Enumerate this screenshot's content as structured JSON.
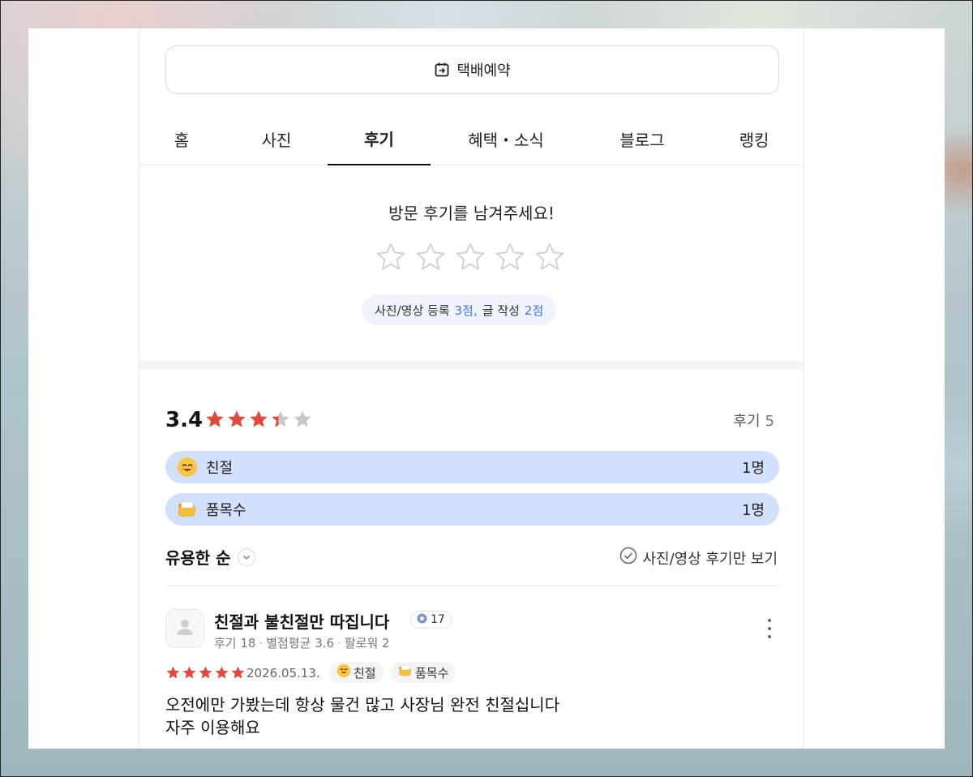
{
  "delivery_button": {
    "label": "택배예약",
    "icon": "calendar-arrow-icon"
  },
  "tabs": [
    {
      "label": "홈"
    },
    {
      "label": "사진"
    },
    {
      "label": "후기",
      "active": true
    },
    {
      "label": "혜택・소식"
    },
    {
      "label": "블로그"
    },
    {
      "label": "랭킹"
    }
  ],
  "write_review": {
    "prompt": "방문 후기를 남겨주세요!",
    "star_count": 5,
    "points": {
      "photo_label": "사진/영상 등록",
      "photo_points": "3점,",
      "text_label": "글 작성",
      "text_points": "2점"
    }
  },
  "summary": {
    "score": "3.4",
    "score_value": 3.4,
    "review_label": "후기",
    "review_count": "5",
    "keywords": [
      {
        "emoji": "smiling-face-icon",
        "label": "친절",
        "count": "1명"
      },
      {
        "emoji": "open-folder-icon",
        "label": "품목수",
        "count": "1명"
      }
    ]
  },
  "controls": {
    "sort_label": "유용한 순",
    "photo_filter_label": "사진/영상 후기만 보기"
  },
  "review": {
    "reviewer_name": "친절과 불친절만 따집니다",
    "level": "17",
    "meta_reviews": "후기 18",
    "meta_avg": "별점평균 3.6",
    "meta_followers": "팔로워 2",
    "rating": 5,
    "date": "2026.05.13.",
    "chips": [
      {
        "emoji": "smiling-face-icon",
        "label": "친절"
      },
      {
        "emoji": "open-folder-icon",
        "label": "품목수"
      }
    ],
    "text_line1": "오전에만 가봤는데 항상 물건 많고 사장님 완전 친절십니다",
    "text_line2": "자주 이용해요"
  },
  "colors": {
    "star_red": "#dc4c3e",
    "star_gray": "#c8c8c8",
    "keyword_bar": "#d3e0fb",
    "points_blue": "#4a77d4"
  }
}
